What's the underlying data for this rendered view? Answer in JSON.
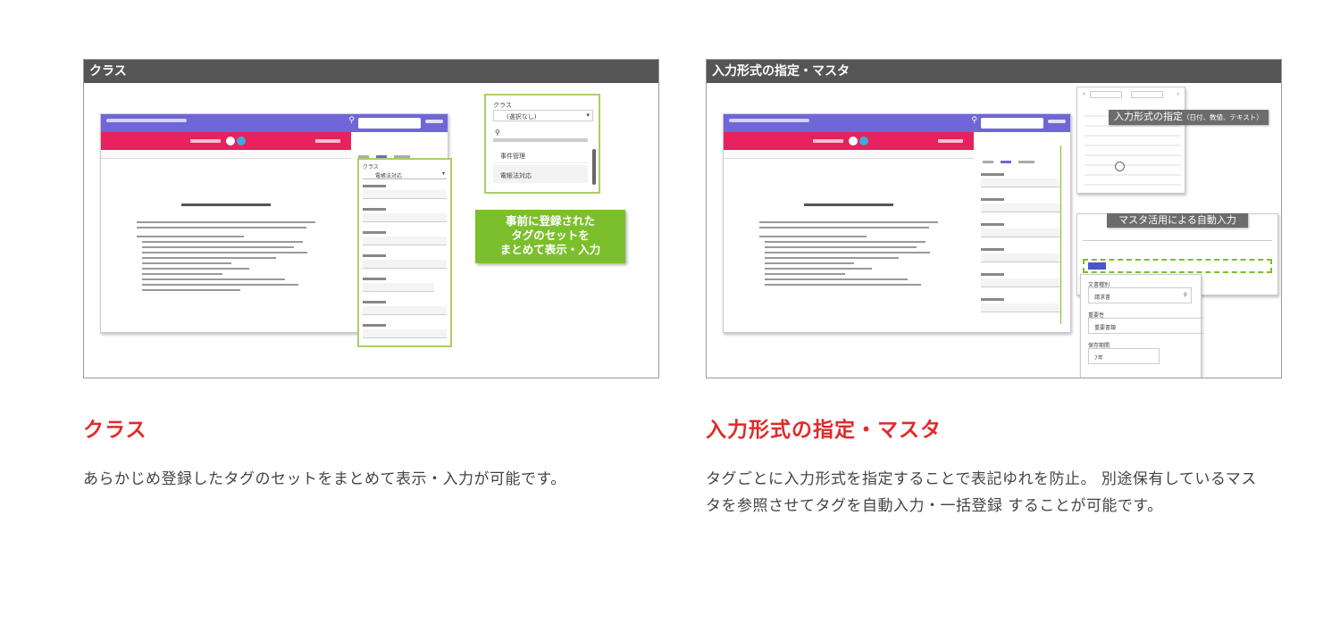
{
  "cards": [
    {
      "header": "クラス",
      "title": "クラス",
      "description": "あらかじめ登録したタグのセットをまとめて表示・入力が可能です。",
      "callout": "事前に登録された\nタグのセットを\nまとめて表示・入力",
      "dropdown": {
        "label": "クラス",
        "selected": "(選択なし)",
        "options": [
          "事件管理",
          "電帳法対応"
        ]
      },
      "side_class_label": "クラス",
      "side_class_value": "電帳法対応"
    },
    {
      "header": "入力形式の指定・マスタ",
      "title": "入力形式の指定・マスタ",
      "description": "タグごとに入力形式を指定することで表記ゆれを防止。 別途保有しているマスタを参照させてタグを自動入力・一括登録 することが可能です。",
      "label_input_format": "入力形式の指定",
      "label_input_format_sub": "（日付、数値、テキスト）",
      "label_master": "マスタ活用による自動入力",
      "master_fields": [
        {
          "label": "文書種別",
          "value": "請求書"
        },
        {
          "label": "重要性",
          "value": "重要書類"
        },
        {
          "label": "保存期間",
          "value": "7年"
        }
      ]
    }
  ],
  "colors": {
    "accent_red": "#e02a2a",
    "app_bar": "#6f66d8",
    "pink_bar": "#e8215f",
    "green": "#7cbf2c",
    "header_gray": "#555555"
  }
}
